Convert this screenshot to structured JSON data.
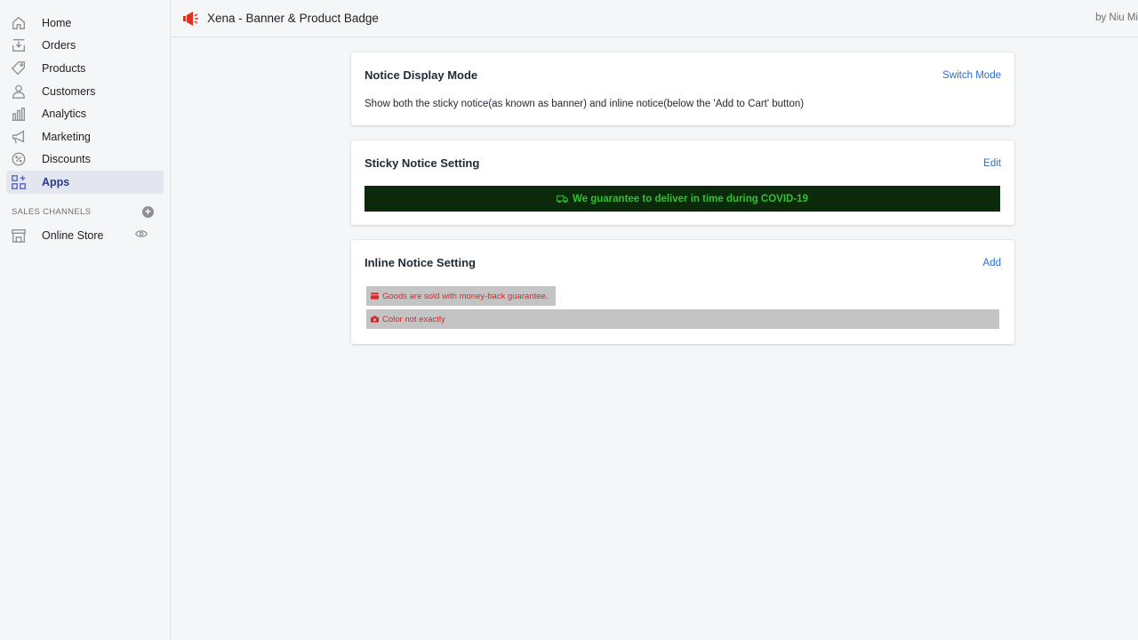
{
  "sidebar": {
    "items": [
      {
        "label": "Home",
        "icon": "home-icon"
      },
      {
        "label": "Orders",
        "icon": "orders-icon"
      },
      {
        "label": "Products",
        "icon": "tag-icon"
      },
      {
        "label": "Customers",
        "icon": "person-icon"
      },
      {
        "label": "Analytics",
        "icon": "bar-chart-icon"
      },
      {
        "label": "Marketing",
        "icon": "megaphone-icon"
      },
      {
        "label": "Discounts",
        "icon": "discount-icon"
      },
      {
        "label": "Apps",
        "icon": "apps-icon",
        "active": true
      }
    ],
    "sales_channels_label": "SALES CHANNELS",
    "channels": [
      {
        "label": "Online Store",
        "icon": "store-icon"
      }
    ]
  },
  "topbar": {
    "app_title": "Xena - Banner & Product Badge",
    "by_text": "by Niu Mi"
  },
  "notice_mode": {
    "title": "Notice Display Mode",
    "action": "Switch Mode",
    "description": "Show both the sticky notice(as known as banner) and inline notice(below the 'Add to Cart' button)"
  },
  "sticky": {
    "title": "Sticky Notice Setting",
    "action": "Edit",
    "banner_text": "We guarantee to deliver in time during COVID-19",
    "banner_bg": "#0b2a0b",
    "banner_color": "#31c231"
  },
  "inline": {
    "title": "Inline Notice Setting",
    "action": "Add",
    "badges": [
      {
        "text": "Goods are sold with money-back guarantee.",
        "icon": "credit-card-icon"
      },
      {
        "text": "Color not exactly",
        "icon": "camera-icon"
      }
    ],
    "badge_bg": "#c4c4c4",
    "badge_color": "#e02424"
  }
}
